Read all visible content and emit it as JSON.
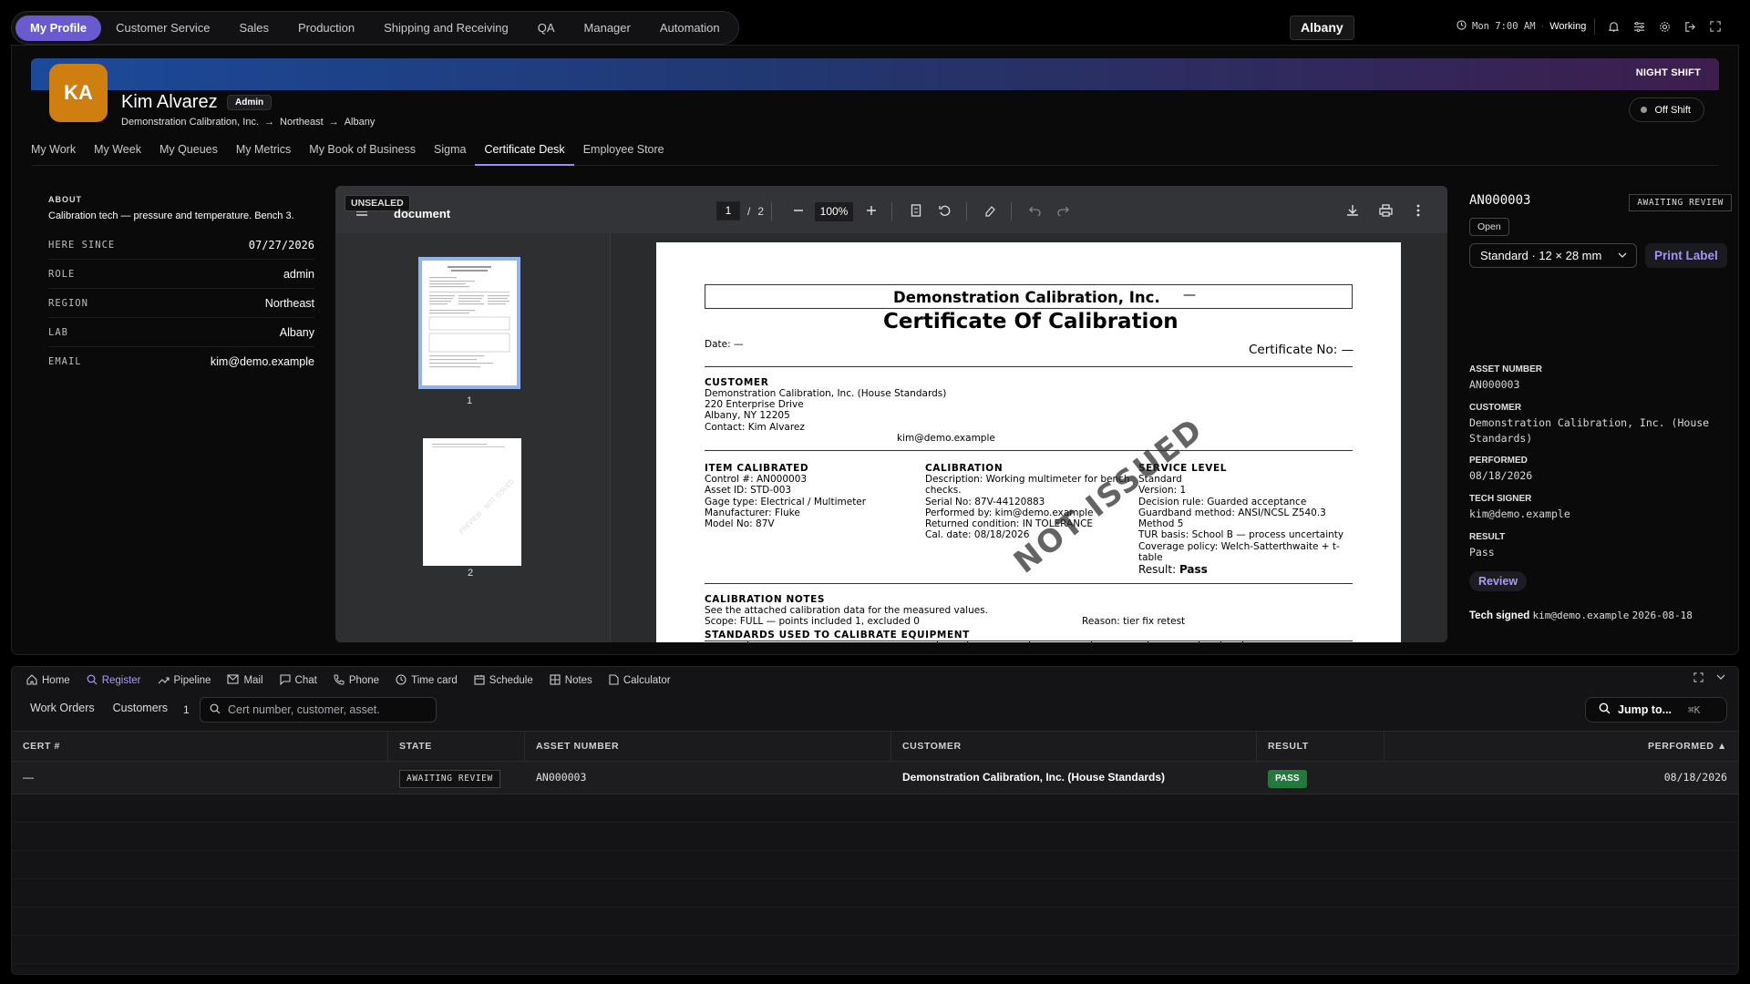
{
  "nav": {
    "items": [
      "My Profile",
      "Customer Service",
      "Sales",
      "Production",
      "Shipping and Receiving",
      "QA",
      "Manager",
      "Automation"
    ],
    "location": "Albany",
    "clock": "Mon 7:00 AM",
    "status": "Working"
  },
  "profile": {
    "initials": "KA",
    "name": "Kim Alvarez",
    "role_badge": "Admin",
    "company": "Demonstration Calibration, Inc.",
    "region": "Northeast",
    "lab": "Albany",
    "banner_label": "NIGHT SHIFT",
    "shift_status": "Off Shift"
  },
  "subtabs": [
    "My Work",
    "My Week",
    "My Queues",
    "My Metrics",
    "My Book of Business",
    "Sigma",
    "Certificate Desk",
    "Employee Store"
  ],
  "about": {
    "title": "ABOUT",
    "text": "Calibration tech — pressure and temperature. Bench 3.",
    "rows": [
      {
        "k": "HERE SINCE",
        "v": "07/27/2026"
      },
      {
        "k": "ROLE",
        "v": "admin"
      },
      {
        "k": "REGION",
        "v": "Northeast"
      },
      {
        "k": "LAB",
        "v": "Albany"
      },
      {
        "k": "EMAIL",
        "v": "kim@demo.example"
      }
    ]
  },
  "viewer": {
    "badge": "UNSEALED",
    "doc_title": "document",
    "page_current": "1",
    "page_sep": "/",
    "page_total": "2",
    "zoom": "100%",
    "thumb_labels": [
      "1",
      "2"
    ]
  },
  "pdf": {
    "company": "Demonstration Calibration, Inc.",
    "company_dash": "—",
    "title": "Certificate Of Calibration",
    "date": "Date: —",
    "cert_no": "Certificate No: —",
    "customer_h": "CUSTOMER",
    "customer_lines": [
      "Demonstration Calibration, Inc. (House Standards)",
      "220 Enterprise Drive",
      "Albany, NY 12205",
      "Contact: Kim Alvarez"
    ],
    "customer_email": "kim@demo.example",
    "item_h": "ITEM CALIBRATED",
    "item_lines": [
      "Control #: AN000003",
      "Asset ID: STD-003",
      "Gage type: Electrical / Multimeter",
      "Manufacturer: Fluke",
      "Model No: 87V"
    ],
    "cal_h": "CALIBRATION",
    "cal_lines": [
      "Description: Working multimeter for bench",
      "checks.",
      "Serial No: 87V-44120883",
      "Performed by: kim@demo.example",
      "Returned condition: IN TOLERANCE",
      "Cal. date: 08/18/2026"
    ],
    "svc_h": "SERVICE LEVEL",
    "svc_lines": [
      "Standard",
      "Version: 1",
      "Decision rule: Guarded acceptance",
      "Guardband method: ANSI/NCSL Z540.3",
      "Method 5",
      "TUR basis: School B — process uncertainty",
      "Coverage policy: Welch-Satterthwaite + t-",
      "table"
    ],
    "result_label": "Result: ",
    "result_value": "Pass",
    "notes_h": "CALIBRATION NOTES",
    "notes_lines": [
      "See the attached calibration data for the measured values.",
      "Scope: FULL — points included 1, excluded 0"
    ],
    "reason": "Reason: tier fix retest",
    "standards_h": "STANDARDS USED TO CALIBRATE EQUIPMENT",
    "watermark": "NOT ISSUED"
  },
  "details": {
    "asset_id": "AN000003",
    "state": "AWAITING REVIEW",
    "open_label": "Open",
    "label_select": "Standard · 12 × 28 mm",
    "print_label": "Print Label",
    "fields": [
      {
        "k": "ASSET NUMBER",
        "v": "AN000003"
      },
      {
        "k": "CUSTOMER",
        "v": "Demonstration Calibration, Inc. (House Standards)"
      },
      {
        "k": "PERFORMED",
        "v": "08/18/2026"
      },
      {
        "k": "TECH SIGNER",
        "v": "kim@demo.example"
      },
      {
        "k": "RESULT",
        "v": "Pass"
      }
    ],
    "review_label": "Review",
    "tech_signed_label": "Tech signed",
    "tech_signed_email": "kim@demo.example",
    "tech_signed_date": "2026-08-18"
  },
  "dock": {
    "items": [
      "Home",
      "Register",
      "Pipeline",
      "Mail",
      "Chat",
      "Phone",
      "Time card",
      "Schedule",
      "Notes",
      "Calculator"
    ]
  },
  "register": {
    "tabs": [
      "Work Orders",
      "Customers"
    ],
    "count": "1",
    "search_placeholder": "Cert number, customer, asset.",
    "jump_label": "Jump to...",
    "jump_kbd": "⌘K",
    "columns": [
      "CERT #",
      "STATE",
      "ASSET NUMBER",
      "CUSTOMER",
      "RESULT",
      "PERFORMED ▲"
    ],
    "rows": [
      {
        "cert": "—",
        "state": "AWAITING REVIEW",
        "asset": "AN000003",
        "customer": "Demonstration Calibration, Inc. (House Standards)",
        "result": "PASS",
        "performed": "08/18/2026"
      }
    ]
  }
}
